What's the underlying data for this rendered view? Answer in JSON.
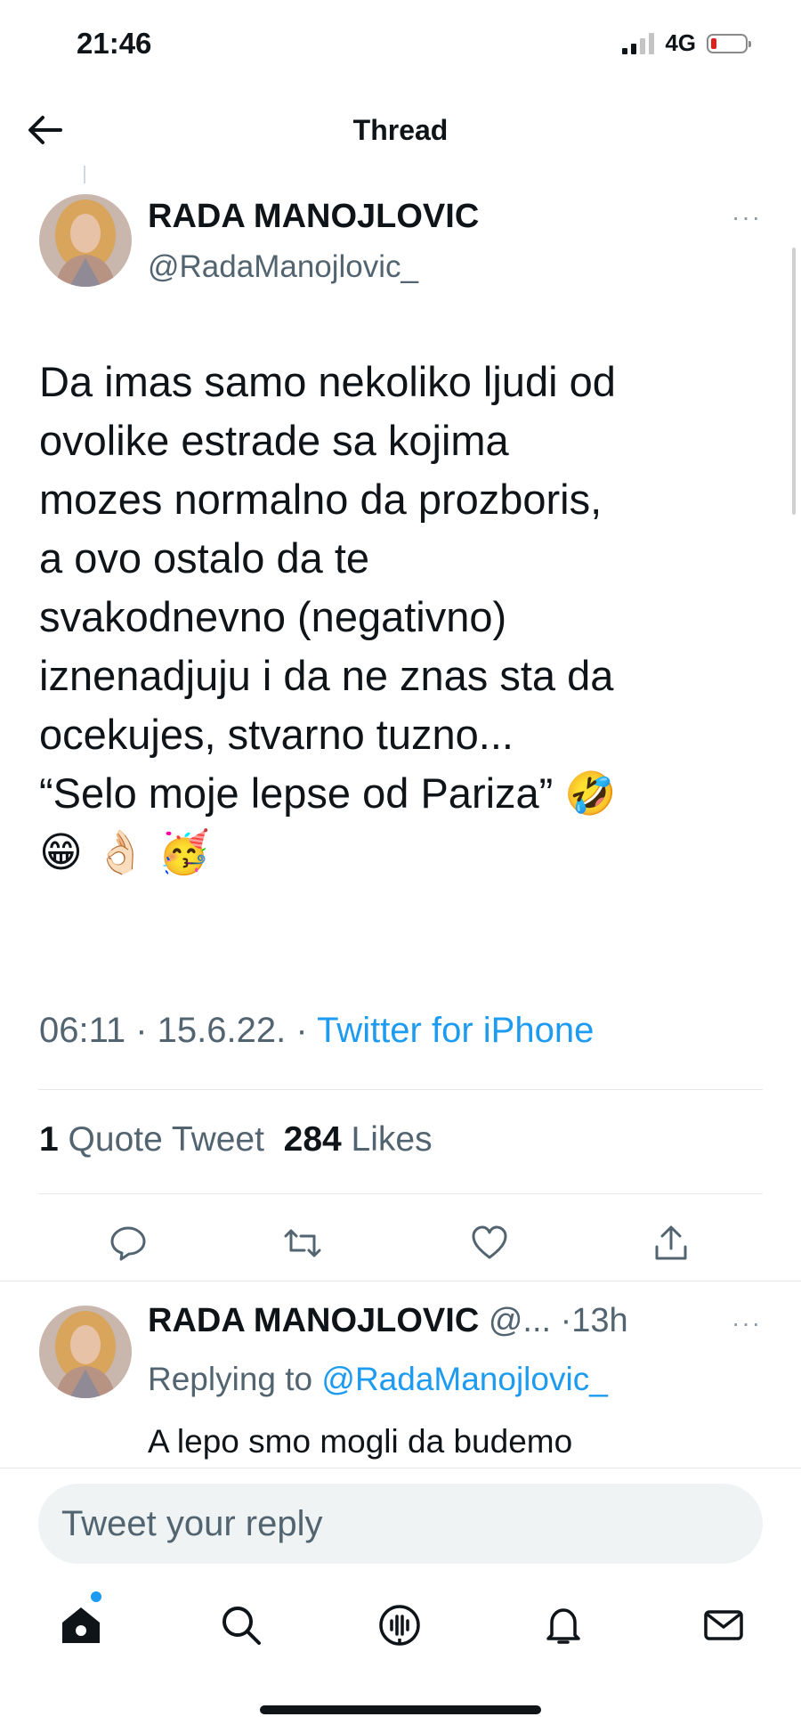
{
  "status_bar": {
    "time": "21:46",
    "network": "4G",
    "battery_color": "#e0201b"
  },
  "header": {
    "title": "Thread"
  },
  "tweet": {
    "author_name": "RADA MANOJLOVIC",
    "author_handle": "@RadaManojlovic_",
    "more_label": "···",
    "text": "Da imas samo nekoliko ljudi od\novolike estrade sa kojima\nmozes normalno da prozboris,\na ovo ostalo da te\nsvakodnevno (negativno)\niznenadjuju i da ne znas sta da\nocekujes, stvarno tuzno...\n“Selo moje lepse od Pariza” 🤣\n😁 👌🏻 🥳",
    "time": "06:11 · 15.6.22. · ",
    "source": "Twitter for iPhone",
    "quote_count": "1",
    "quote_label": " Quote Tweet",
    "like_count": "284",
    "like_label": " Likes",
    "actions": [
      "reply-icon",
      "retweet-icon",
      "like-icon",
      "share-icon"
    ]
  },
  "reply": {
    "author_name": "RADA MANOJLOVIC",
    "handle_truncated": " @...",
    "time": " ·13h",
    "more_label": "···",
    "replying_prefix": "Replying to ",
    "replying_to": "@RadaManojlovic_",
    "text": "A lepo smo mogli da budemo"
  },
  "compose": {
    "placeholder": "Tweet your reply"
  },
  "bottom_nav": {
    "items": [
      "home-icon",
      "search-icon",
      "spaces-icon",
      "notifications-icon",
      "messages-icon"
    ]
  },
  "colors": {
    "accent": "#1d9bf0",
    "text": "#0f1419",
    "muted": "#536471"
  }
}
